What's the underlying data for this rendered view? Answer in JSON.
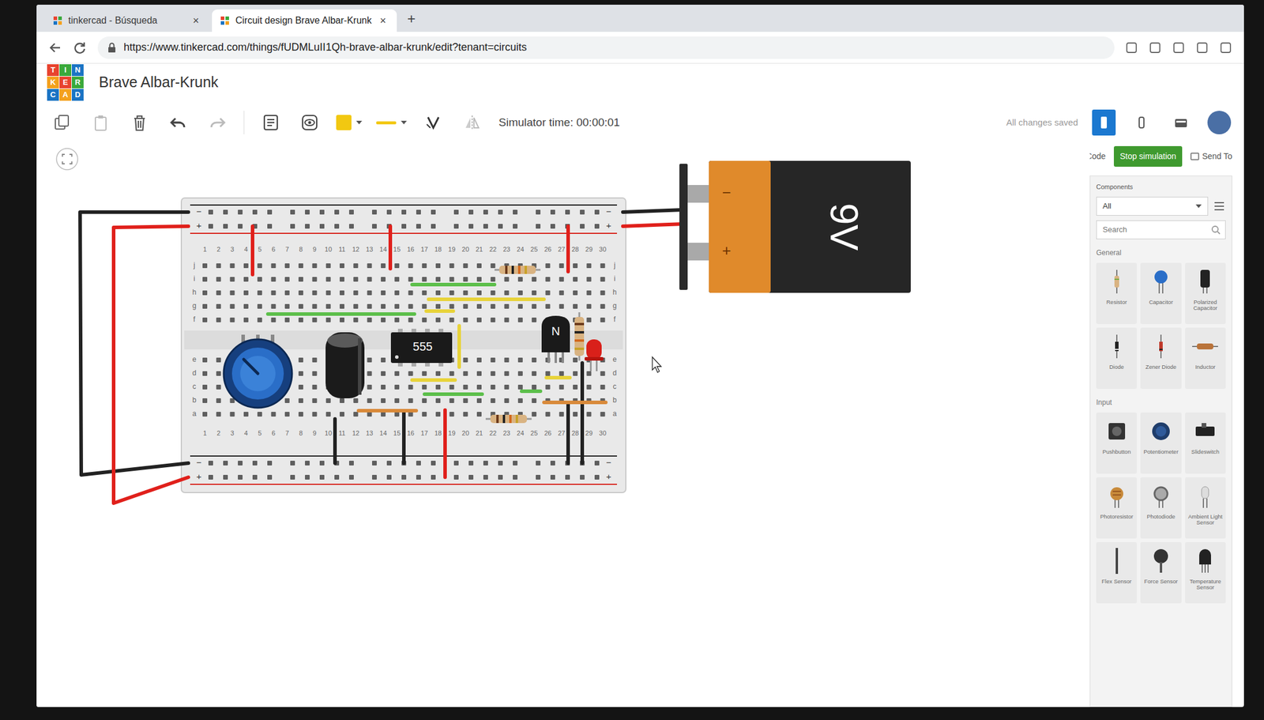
{
  "browser": {
    "tabs": [
      {
        "label": "tinkercad - Búsqueda",
        "selected": false,
        "close": "×"
      },
      {
        "label": "Circuit design Brave Albar-Krunk",
        "selected": true,
        "close": "×"
      }
    ],
    "new_tab": "+",
    "url": "https://www.tinkercad.com/things/fUDMLuII1Qh-brave-albar-krunk/edit?tenant=circuits"
  },
  "app": {
    "logo": [
      {
        "letter": "T",
        "color": "#e8432e"
      },
      {
        "letter": "I",
        "color": "#3aa93b"
      },
      {
        "letter": "N",
        "color": "#1a74c4"
      },
      {
        "letter": "K",
        "color": "#f4a11d"
      },
      {
        "letter": "E",
        "color": "#e8432e"
      },
      {
        "letter": "R",
        "color": "#3aa93b"
      },
      {
        "letter": "C",
        "color": "#1a74c4"
      },
      {
        "letter": "A",
        "color": "#f4a11d"
      },
      {
        "letter": "D",
        "color": "#1a74c4"
      }
    ],
    "title": "Brave Albar-Krunk",
    "save_status": "All changes saved"
  },
  "toolbar": {
    "simulator_time": "Simulator time: 00:00:01",
    "fill_color": "#f2c811",
    "line_color": "#f2c811"
  },
  "actions": [
    {
      "label": "Code",
      "kind": "link"
    },
    {
      "label": "Stop simulation",
      "kind": "primary"
    },
    {
      "label": "Send To",
      "kind": "link"
    }
  ],
  "components_panel": {
    "label": "Components",
    "filter": "All",
    "search_placeholder": "Search",
    "sections": [
      {
        "title": "General",
        "items": [
          {
            "label": "Resistor",
            "kind": "resistor"
          },
          {
            "label": "Capacitor",
            "kind": "capacitor"
          },
          {
            "label": "Polarized Capacitor",
            "kind": "polarized"
          },
          {
            "label": "Diode",
            "kind": "diode"
          },
          {
            "label": "Zener Diode",
            "kind": "zener"
          },
          {
            "label": "Inductor",
            "kind": "inductor"
          }
        ]
      },
      {
        "title": "Input",
        "items": [
          {
            "label": "Pushbutton",
            "kind": "pushbutton"
          },
          {
            "label": "Potentiometer",
            "kind": "potentiometer"
          },
          {
            "label": "Slideswitch",
            "kind": "slideswitch"
          },
          {
            "label": "Photoresistor",
            "kind": "photoresistor"
          },
          {
            "label": "Photodiode",
            "kind": "photodiode"
          },
          {
            "label": "Ambient Light Sensor",
            "kind": "ambient"
          },
          {
            "label": "Flex Sensor",
            "kind": "flex"
          },
          {
            "label": "Force Sensor",
            "kind": "force"
          },
          {
            "label": "Temperature Sensor",
            "kind": "temperature"
          }
        ]
      }
    ]
  },
  "breadboard": {
    "columns": [
      "1",
      "2",
      "3",
      "4",
      "5",
      "6",
      "7",
      "8",
      "9",
      "10",
      "11",
      "12",
      "13",
      "14",
      "15",
      "16",
      "17",
      "18",
      "19",
      "20",
      "21",
      "22",
      "23",
      "24",
      "25",
      "26",
      "27",
      "28",
      "29",
      "30"
    ],
    "rows_top": [
      "j",
      "i",
      "h",
      "g",
      "f"
    ],
    "rows_bottom": [
      "e",
      "d",
      "c",
      "b",
      "a"
    ],
    "rails": [
      "−",
      "+"
    ]
  },
  "parts": {
    "chip": "555",
    "transistor": "N",
    "battery": {
      "label": "9V",
      "negative": "−",
      "positive": "+"
    }
  },
  "wires": [
    {
      "color": "#e0201b"
    },
    {
      "color": "#e0201b"
    },
    {
      "color": "#e0201b"
    },
    {
      "color": "#222222"
    },
    {
      "color": "#222222"
    },
    {
      "color": "#e0201b"
    },
    {
      "color": "#222222"
    },
    {
      "color": "#222222"
    },
    {
      "color": "#5cbf4a"
    },
    {
      "color": "#5cbf4a"
    },
    {
      "color": "#e8d33a"
    },
    {
      "color": "#e8d33a"
    },
    {
      "color": "#e8d33a"
    },
    {
      "color": "#e8d33a"
    },
    {
      "color": "#5cbf4a"
    },
    {
      "color": "#d98a3a"
    },
    {
      "color": "#e8d33a"
    },
    {
      "color": "#d98a3a"
    },
    {
      "color": "#5cbf4a"
    },
    {
      "color": "#222222"
    },
    {
      "color": "#e0201b"
    },
    {
      "color": "#222222"
    },
    {
      "color": "#e0201b"
    }
  ]
}
